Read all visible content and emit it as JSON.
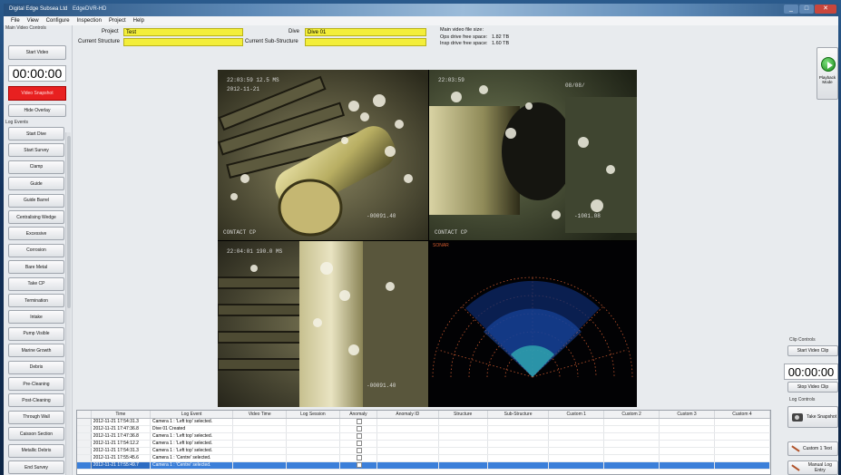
{
  "window": {
    "title": "Digital Edge Subsea Ltd",
    "app_title": "EdgeDVR-HD",
    "controls": [
      "_",
      "□",
      "✕"
    ]
  },
  "menu": [
    "File",
    "View",
    "Configure",
    "Inspection",
    "Project",
    "Help"
  ],
  "left_panel": {
    "section_title": "Main Video Controls",
    "start_video": "Start Video",
    "timer": "00:00:00",
    "video_snapshot": "Video Snapshot",
    "hide_overlay": "Hide Overlay",
    "log_events_title": "Log Events",
    "log_events": [
      "Start Dive",
      "Start Survey",
      "Clamp",
      "Guide",
      "Guide Barrel",
      "Centralising Wedge",
      "Excessive",
      "Corrosion",
      "Bare Metal",
      "Take CP",
      "Termination",
      "Intake",
      "Pump Visible",
      "Marine Growth",
      "Debris",
      "Pre-Cleaning",
      "Post-Cleaning",
      "Through Wall",
      "Caisson Section",
      "Metallic Debris",
      "End Survey"
    ]
  },
  "header": {
    "project_label": "Project",
    "project_value": "Test",
    "dive_label": "Dive",
    "dive_value": "Dive 01",
    "structure_label": "Current Structure",
    "structure_value": "",
    "substructure_label": "Current Sub-Structure",
    "substructure_value": "",
    "file_size_label": "Main video file size:",
    "ops_label": "Ops drive free space:",
    "ops_value": "1.82 TB",
    "insp_label": "Insp drive free space:",
    "insp_value": "1.60 TB"
  },
  "video_overlays": {
    "tl_top1": "22:03:59  12.5 MS",
    "tl_top2": "2012-11-21",
    "tl_bottom": "CONTACT CP",
    "tr_top1": "22:03:59",
    "tr_top2": "08/08/",
    "tr_bottom": "CONTACT CP",
    "tr_val": "-1001.08",
    "bl_top1": "22:04:01  190.0 MS",
    "bl_bottom": "-00091.40",
    "tl_val": "-00091.40",
    "sonar_label": "SONAR"
  },
  "log_table": {
    "columns": [
      "Time",
      "Log Event",
      "Video Time",
      "Log Session",
      "Anomaly",
      "Anomaly ID",
      "Structure",
      "Sub-Structure",
      "Custom 1",
      "Custom 2",
      "Custom 3",
      "Custom 4"
    ],
    "rows": [
      {
        "time": "2012-11-21 17:54:31.3",
        "event": "Camera 1 : 'Left top' selected."
      },
      {
        "time": "2012-11-21 17:47:36.8",
        "event": "Dive 01 Created"
      },
      {
        "time": "2012-11-21 17:47:36.8",
        "event": "Camera 1 : 'Left top' selected."
      },
      {
        "time": "2012-11-21 17:54:12.2",
        "event": "Camera 1 : 'Left top' selected."
      },
      {
        "time": "2012-11-21 17:54:31.3",
        "event": "Camera 1 : 'Left top' selected."
      },
      {
        "time": "2012-11-21 17:55:45.6",
        "event": "Camera 1 : 'Centre' selected."
      },
      {
        "time": "2012-11-21 17:55:49.7",
        "event": "Camera 1 : 'Centre' selected."
      }
    ]
  },
  "right_panel": {
    "playback_label": "Playback Mode",
    "clip_controls_title": "Clip Controls",
    "start_video_clip": "Start Video Clip",
    "clip_timer": "00:00:00",
    "stop_video_clip": "Stop Video Clip",
    "log_controls_title": "Log Controls",
    "take_snapshot": "Take Snapshot",
    "custom_text": "Custom 1 Text",
    "manual_log_entry": "Manual Log Entry"
  },
  "colors": {
    "snapshot_red": "#e82020",
    "yellow_field": "#f3ee3a",
    "selected_row": "#3b7fd9"
  }
}
